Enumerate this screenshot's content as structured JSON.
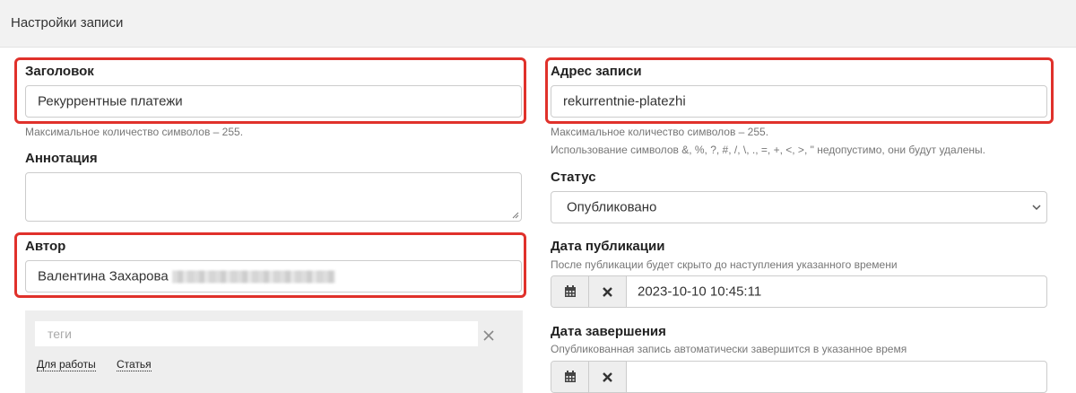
{
  "header": {
    "title": "Настройки записи"
  },
  "left": {
    "title_field": {
      "label": "Заголовок",
      "value": "Рекуррентные платежи",
      "help": "Максимальное количество символов – 255."
    },
    "annotation": {
      "label": "Аннотация",
      "value": ""
    },
    "author": {
      "label": "Автор",
      "value": "Валентина Захарова"
    },
    "tags": {
      "placeholder": "теги",
      "clear_icon": "close-icon",
      "items": [
        "Для работы",
        "Статья"
      ]
    }
  },
  "right": {
    "slug": {
      "label": "Адрес записи",
      "value": "rekurrentnie-platezhi",
      "help1": "Максимальное количество символов – 255.",
      "help2": "Использование символов &, %, ?, #, /, \\, ., =, +, <, >, \" недопустимо, они будут удалены."
    },
    "status": {
      "label": "Статус",
      "value": "Опубликовано"
    },
    "publish_date": {
      "label": "Дата публикации",
      "help": "После публикации будет скрыто до наступления указанного времени",
      "value": "2023-10-10 10:45:11"
    },
    "end_date": {
      "label": "Дата завершения",
      "help": "Опубликованная запись автоматически завершится в указанное время",
      "value": ""
    }
  },
  "colors": {
    "highlight": "#e0312b",
    "header_bg": "#f2f2f2",
    "addon_bg": "#eeeeee"
  }
}
